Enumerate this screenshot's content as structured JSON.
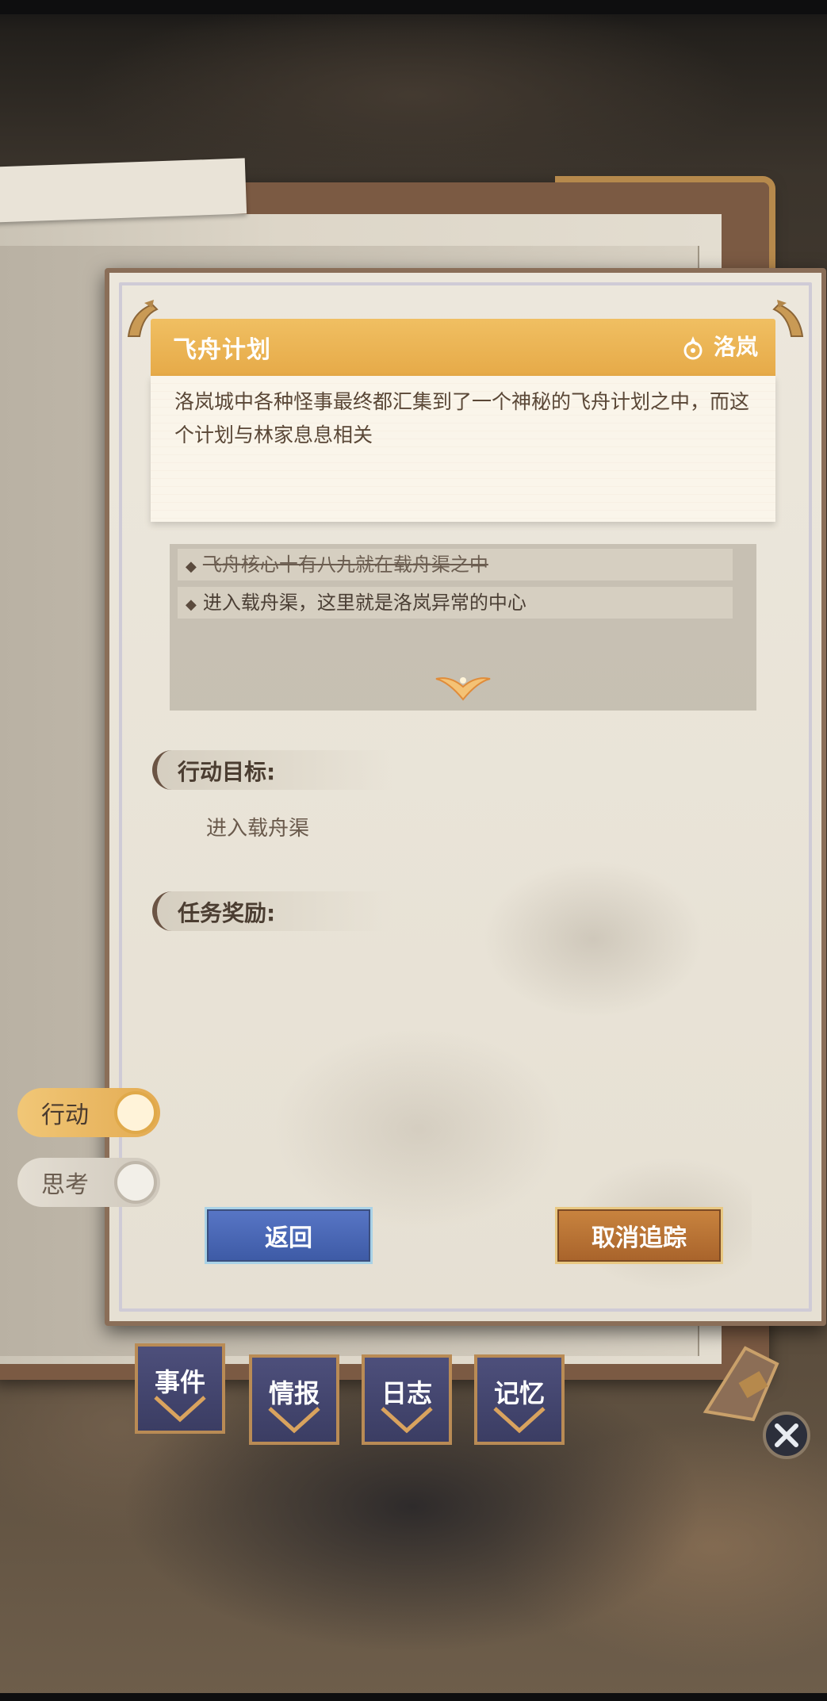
{
  "quest": {
    "title": "飞舟计划",
    "region": "洛岚",
    "description": "洛岚城中各种怪事最终都汇集到了一个神秘的飞舟计划之中，而这个计划与林家息息相关"
  },
  "clues": [
    {
      "text": "飞舟核心十有八九就在载舟渠之中",
      "completed": true
    },
    {
      "text": "进入载舟渠，这里就是洛岚异常的中心",
      "completed": false
    }
  ],
  "objective": {
    "heading": "行动目标:",
    "text": "进入载舟渠"
  },
  "reward": {
    "heading": "任务奖励:"
  },
  "buttons": {
    "back": "返回",
    "cancel_tracking": "取消追踪"
  },
  "side_toggles": {
    "action": "行动",
    "think": "思考",
    "active": "action"
  },
  "tabs": [
    {
      "label": "事件",
      "active": true
    },
    {
      "label": "情报",
      "active": false
    },
    {
      "label": "日志",
      "active": false
    },
    {
      "label": "记忆",
      "active": false
    }
  ],
  "icons": {
    "region": "compass-icon",
    "expand": "chevron-down-icon",
    "close": "close-icon"
  },
  "colors": {
    "title_banner": "#e9b050",
    "back_button": "#4a67b5",
    "cancel_button": "#b87035",
    "tab": "#45476f"
  }
}
